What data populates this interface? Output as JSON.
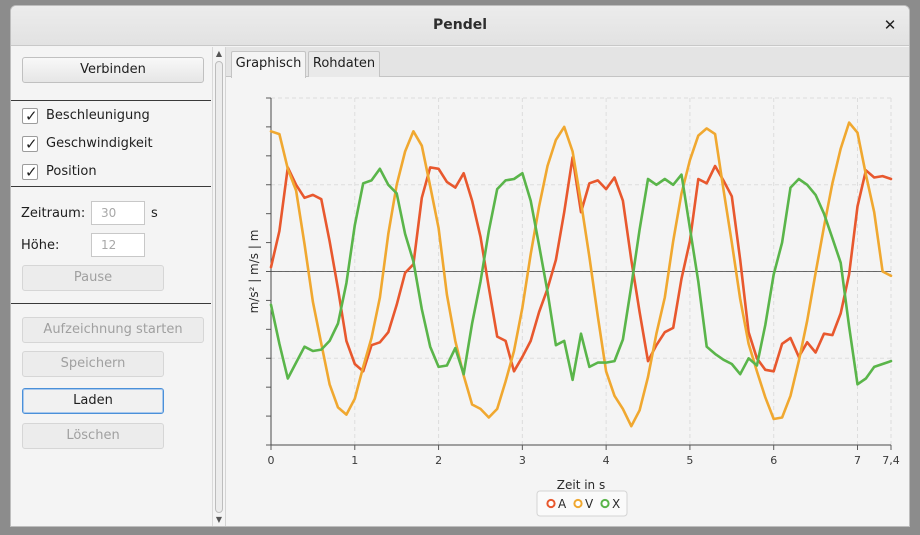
{
  "window": {
    "title": "Pendel"
  },
  "controls": {
    "connect_label": "Verbinden",
    "checkboxes": [
      {
        "label": "Beschleunigung",
        "checked": true
      },
      {
        "label": "Geschwindigkeit",
        "checked": true
      },
      {
        "label": "Position",
        "checked": true
      }
    ],
    "zeitraum_label": "Zeitraum:",
    "zeitraum_value": "30",
    "zeitraum_unit": "s",
    "hoehe_label": "Höhe:",
    "hoehe_value": "12",
    "pause_label": "Pause",
    "record_label": "Aufzeichnung starten",
    "save_label": "Speichern",
    "load_label": "Laden",
    "delete_label": "Löschen"
  },
  "tabs": [
    {
      "label": "Graphisch",
      "active": true
    },
    {
      "label": "Rohdaten",
      "active": false
    }
  ],
  "colors": {
    "A": "#e8582e",
    "V": "#f0a830",
    "X": "#5ab54a"
  },
  "chart_data": {
    "type": "line",
    "xlabel": "Zeit in s",
    "ylabel": "m/s² | m/s | m",
    "xticks": [
      "0",
      "1",
      "2",
      "3",
      "4",
      "5",
      "6",
      "7",
      "7,4"
    ],
    "xlim": [
      0,
      7.4
    ],
    "ylim": [
      -12,
      12
    ],
    "grid": true,
    "legend_position": "bottom-center",
    "series": [
      {
        "name": "A",
        "x": [
          0,
          0.1,
          0.2,
          0.3,
          0.4,
          0.5,
          0.6,
          0.7,
          0.8,
          0.9,
          1.0,
          1.1,
          1.2,
          1.3,
          1.4,
          1.5,
          1.6,
          1.7,
          1.8,
          1.9,
          2.0,
          2.1,
          2.2,
          2.3,
          2.4,
          2.5,
          2.6,
          2.7,
          2.8,
          2.9,
          3.0,
          3.1,
          3.2,
          3.3,
          3.4,
          3.5,
          3.6,
          3.7,
          3.8,
          3.9,
          4.0,
          4.1,
          4.2,
          4.3,
          4.4,
          4.5,
          4.6,
          4.7,
          4.8,
          4.9,
          5.0,
          5.1,
          5.2,
          5.3,
          5.4,
          5.5,
          5.6,
          5.7,
          5.8,
          5.9,
          6.0,
          6.1,
          6.2,
          6.3,
          6.4,
          6.5,
          6.6,
          6.7,
          6.8,
          6.9,
          7.0,
          7.1,
          7.2,
          7.3,
          7.4
        ],
        "y": [
          0.3,
          2.8,
          7.2,
          6.0,
          5.1,
          5.3,
          5.0,
          2.1,
          -1.2,
          -4.8,
          -6.4,
          -6.9,
          -5.1,
          -4.9,
          -4.2,
          -2.3,
          -0.1,
          0.5,
          5.1,
          7.2,
          7.1,
          6.2,
          5.8,
          6.8,
          4.9,
          2.4,
          -1.1,
          -4.5,
          -4.8,
          -6.9,
          -5.9,
          -4.8,
          -2.8,
          -1.2,
          0.8,
          4.1,
          7.9,
          4.1,
          6.1,
          6.3,
          5.7,
          6.5,
          4.9,
          0.8,
          -2.8,
          -6.2,
          -5.1,
          -4.2,
          -3.9,
          -0.5,
          2.1,
          6.4,
          6.1,
          7.3,
          6.3,
          5.2,
          0.8,
          -4.2,
          -6.0,
          -6.8,
          -6.9,
          -5.0,
          -4.6,
          -5.9,
          -4.9,
          -5.6,
          -4.3,
          -4.4,
          -2.9,
          -0.2,
          4.5,
          7.0,
          6.5,
          6.6,
          6.4
        ]
      },
      {
        "name": "V",
        "x": [
          0,
          0.1,
          0.2,
          0.3,
          0.4,
          0.5,
          0.6,
          0.7,
          0.8,
          0.9,
          1.0,
          1.1,
          1.2,
          1.3,
          1.4,
          1.5,
          1.6,
          1.7,
          1.8,
          1.9,
          2.0,
          2.1,
          2.2,
          2.3,
          2.4,
          2.5,
          2.6,
          2.7,
          2.8,
          2.9,
          3.0,
          3.1,
          3.2,
          3.3,
          3.4,
          3.5,
          3.6,
          3.7,
          3.8,
          3.9,
          4.0,
          4.1,
          4.2,
          4.3,
          4.4,
          4.5,
          4.6,
          4.7,
          4.8,
          4.9,
          5.0,
          5.1,
          5.2,
          5.3,
          5.4,
          5.5,
          5.6,
          5.7,
          5.8,
          5.9,
          6.0,
          6.1,
          6.2,
          6.3,
          6.4,
          6.5,
          6.6,
          6.7,
          6.8,
          6.9,
          7.0,
          7.1,
          7.2,
          7.3,
          7.4
        ],
        "y": [
          9.7,
          9.5,
          7.1,
          5.6,
          1.9,
          -2.1,
          -5.0,
          -7.8,
          -9.4,
          -9.9,
          -8.8,
          -6.6,
          -4.6,
          -1.8,
          2.6,
          6.0,
          8.3,
          9.7,
          8.7,
          5.9,
          3.0,
          -1.6,
          -4.8,
          -7.2,
          -9.2,
          -9.5,
          -10.1,
          -9.5,
          -7.6,
          -5.5,
          -2.5,
          1.2,
          4.5,
          7.3,
          9.1,
          10.0,
          8.3,
          4.8,
          1.0,
          -3.1,
          -6.9,
          -8.6,
          -9.5,
          -10.7,
          -9.6,
          -7.3,
          -4.3,
          -1.8,
          2.1,
          5.4,
          7.7,
          9.4,
          9.9,
          9.5,
          5.7,
          2.0,
          -1.9,
          -5.0,
          -6.9,
          -8.7,
          -10.2,
          -10.1,
          -8.6,
          -6.2,
          -3.4,
          -0.1,
          3.1,
          6.1,
          8.5,
          10.3,
          9.6,
          6.7,
          4.1,
          0.0,
          -0.3
        ]
      },
      {
        "name": "X",
        "x": [
          0,
          0.1,
          0.2,
          0.3,
          0.4,
          0.5,
          0.6,
          0.7,
          0.8,
          0.9,
          1.0,
          1.1,
          1.2,
          1.3,
          1.4,
          1.5,
          1.6,
          1.7,
          1.8,
          1.9,
          2.0,
          2.1,
          2.2,
          2.3,
          2.4,
          2.5,
          2.6,
          2.7,
          2.8,
          2.9,
          3.0,
          3.1,
          3.2,
          3.3,
          3.4,
          3.5,
          3.6,
          3.7,
          3.8,
          3.9,
          4.0,
          4.1,
          4.2,
          4.3,
          4.4,
          4.5,
          4.6,
          4.7,
          4.8,
          4.9,
          5.0,
          5.1,
          5.2,
          5.3,
          5.4,
          5.5,
          5.6,
          5.7,
          5.8,
          5.9,
          6.0,
          6.1,
          6.2,
          6.3,
          6.4,
          6.5,
          6.6,
          6.7,
          6.8,
          6.9,
          7.0,
          7.1,
          7.2,
          7.3,
          7.4
        ],
        "y": [
          -2.3,
          -5.0,
          -7.4,
          -6.3,
          -5.2,
          -5.5,
          -5.4,
          -4.8,
          -3.6,
          -0.8,
          3.2,
          6.1,
          6.3,
          7.1,
          6.0,
          5.4,
          2.6,
          0.7,
          -2.6,
          -5.2,
          -6.6,
          -6.5,
          -5.3,
          -7.1,
          -3.6,
          -0.7,
          2.8,
          5.7,
          6.3,
          6.4,
          6.8,
          4.9,
          1.8,
          -1.4,
          -5.1,
          -4.8,
          -7.5,
          -4.3,
          -6.6,
          -6.3,
          -6.3,
          -6.2,
          -4.7,
          -1.0,
          2.9,
          6.4,
          6.0,
          6.4,
          6.0,
          6.7,
          3.0,
          -0.7,
          -5.2,
          -5.7,
          -6.1,
          -6.4,
          -7.1,
          -6.0,
          -6.5,
          -3.7,
          -0.2,
          2.0,
          5.8,
          6.4,
          6.0,
          5.3,
          4.0,
          2.3,
          0.6,
          -3.8,
          -7.8,
          -7.4,
          -6.6,
          -6.4,
          -6.2
        ]
      }
    ]
  }
}
